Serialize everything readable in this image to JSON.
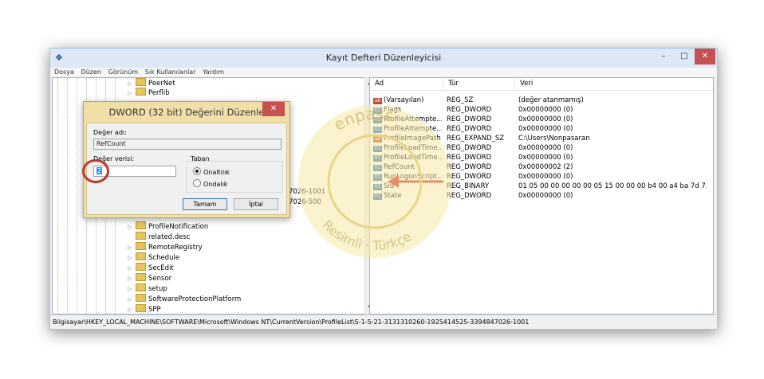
{
  "window": {
    "title": "Kayıt Defteri Düzenleyicisi",
    "min_glyph": "–",
    "max_glyph": "□",
    "close_glyph": "✕"
  },
  "menu": [
    "Dosya",
    "Düzen",
    "Görünüm",
    "Sık Kullanılanlar",
    "Yardım"
  ],
  "tree": {
    "items": [
      {
        "label": "PeerNet"
      },
      {
        "label": "Perflib"
      },
      {
        "label": "ProfileNotification"
      },
      {
        "label": "related.desc"
      },
      {
        "label": "RemoteRegistry"
      },
      {
        "label": "Schedule"
      },
      {
        "label": "SecEdit"
      },
      {
        "label": "Sensor"
      },
      {
        "label": "setup"
      },
      {
        "label": "SoftwareProtectionPlatform"
      },
      {
        "label": "SPP"
      }
    ],
    "partial": [
      "7026-1001",
      "7026-500"
    ]
  },
  "list": {
    "columns": [
      "Ad",
      "Tür",
      "Veri"
    ],
    "rows": [
      {
        "name": "(Varsayılan)",
        "type": "REG_SZ",
        "data": "(değer atanmamış)",
        "icon": "ab"
      },
      {
        "name": "Flags",
        "type": "REG_DWORD",
        "data": "0x00000000 (0)",
        "icon": "bin"
      },
      {
        "name": "ProfileAttempte...",
        "type": "REG_DWORD",
        "data": "0x00000000 (0)",
        "icon": "bin"
      },
      {
        "name": "ProfileAttempte...",
        "type": "REG_DWORD",
        "data": "0x00000000 (0)",
        "icon": "bin"
      },
      {
        "name": "ProfileImagePath",
        "type": "REG_EXPAND_SZ",
        "data": "C:\\Users\\Nonpasaran",
        "icon": "ab"
      },
      {
        "name": "ProfileLoadTime...",
        "type": "REG_DWORD",
        "data": "0x00000000 (0)",
        "icon": "bin"
      },
      {
        "name": "ProfileLoadTime...",
        "type": "REG_DWORD",
        "data": "0x00000000 (0)",
        "icon": "bin"
      },
      {
        "name": "RefCount",
        "type": "REG_DWORD",
        "data": "0x00000002 (2)",
        "icon": "bin"
      },
      {
        "name": "RunLogonScript...",
        "type": "REG_DWORD",
        "data": "0x00000000 (0)",
        "icon": "bin"
      },
      {
        "name": "Sid",
        "type": "REG_BINARY",
        "data": "01 05 00 00 00 00 00 05 15 00 00 00 b4 00 a4 ba 7d 7...",
        "icon": "bin"
      },
      {
        "name": "State",
        "type": "REG_DWORD",
        "data": "0x00000000 (0)",
        "icon": "bin"
      }
    ]
  },
  "status": "Bilgisayar\\HKEY_LOCAL_MACHINE\\SOFTWARE\\Microsoft\\Windows NT\\CurrentVersion\\ProfileList\\S-1-5-21-3131310260-1925414525-3394847026-1001",
  "dialog": {
    "title": "DWORD (32 bit) Değerini Düzenle",
    "value_name_label": "Değer adı:",
    "value_name": "RefCount",
    "value_data_label": "Değer verisi:",
    "value_data": "2",
    "base_label": "Taban",
    "hex_label": "Onaltılık",
    "dec_label": "Ondalık",
    "ok_label": "Tamam",
    "cancel_label": "İptal",
    "close_glyph": "✕"
  },
  "watermark": {
    "top_text": "enpass",
    "bottom_text": "Resimli · Türkçe"
  },
  "colors": {
    "accent": "#c0392b",
    "dialog_frame": "#f0e0a8",
    "titlebar": "#dce8f5"
  }
}
